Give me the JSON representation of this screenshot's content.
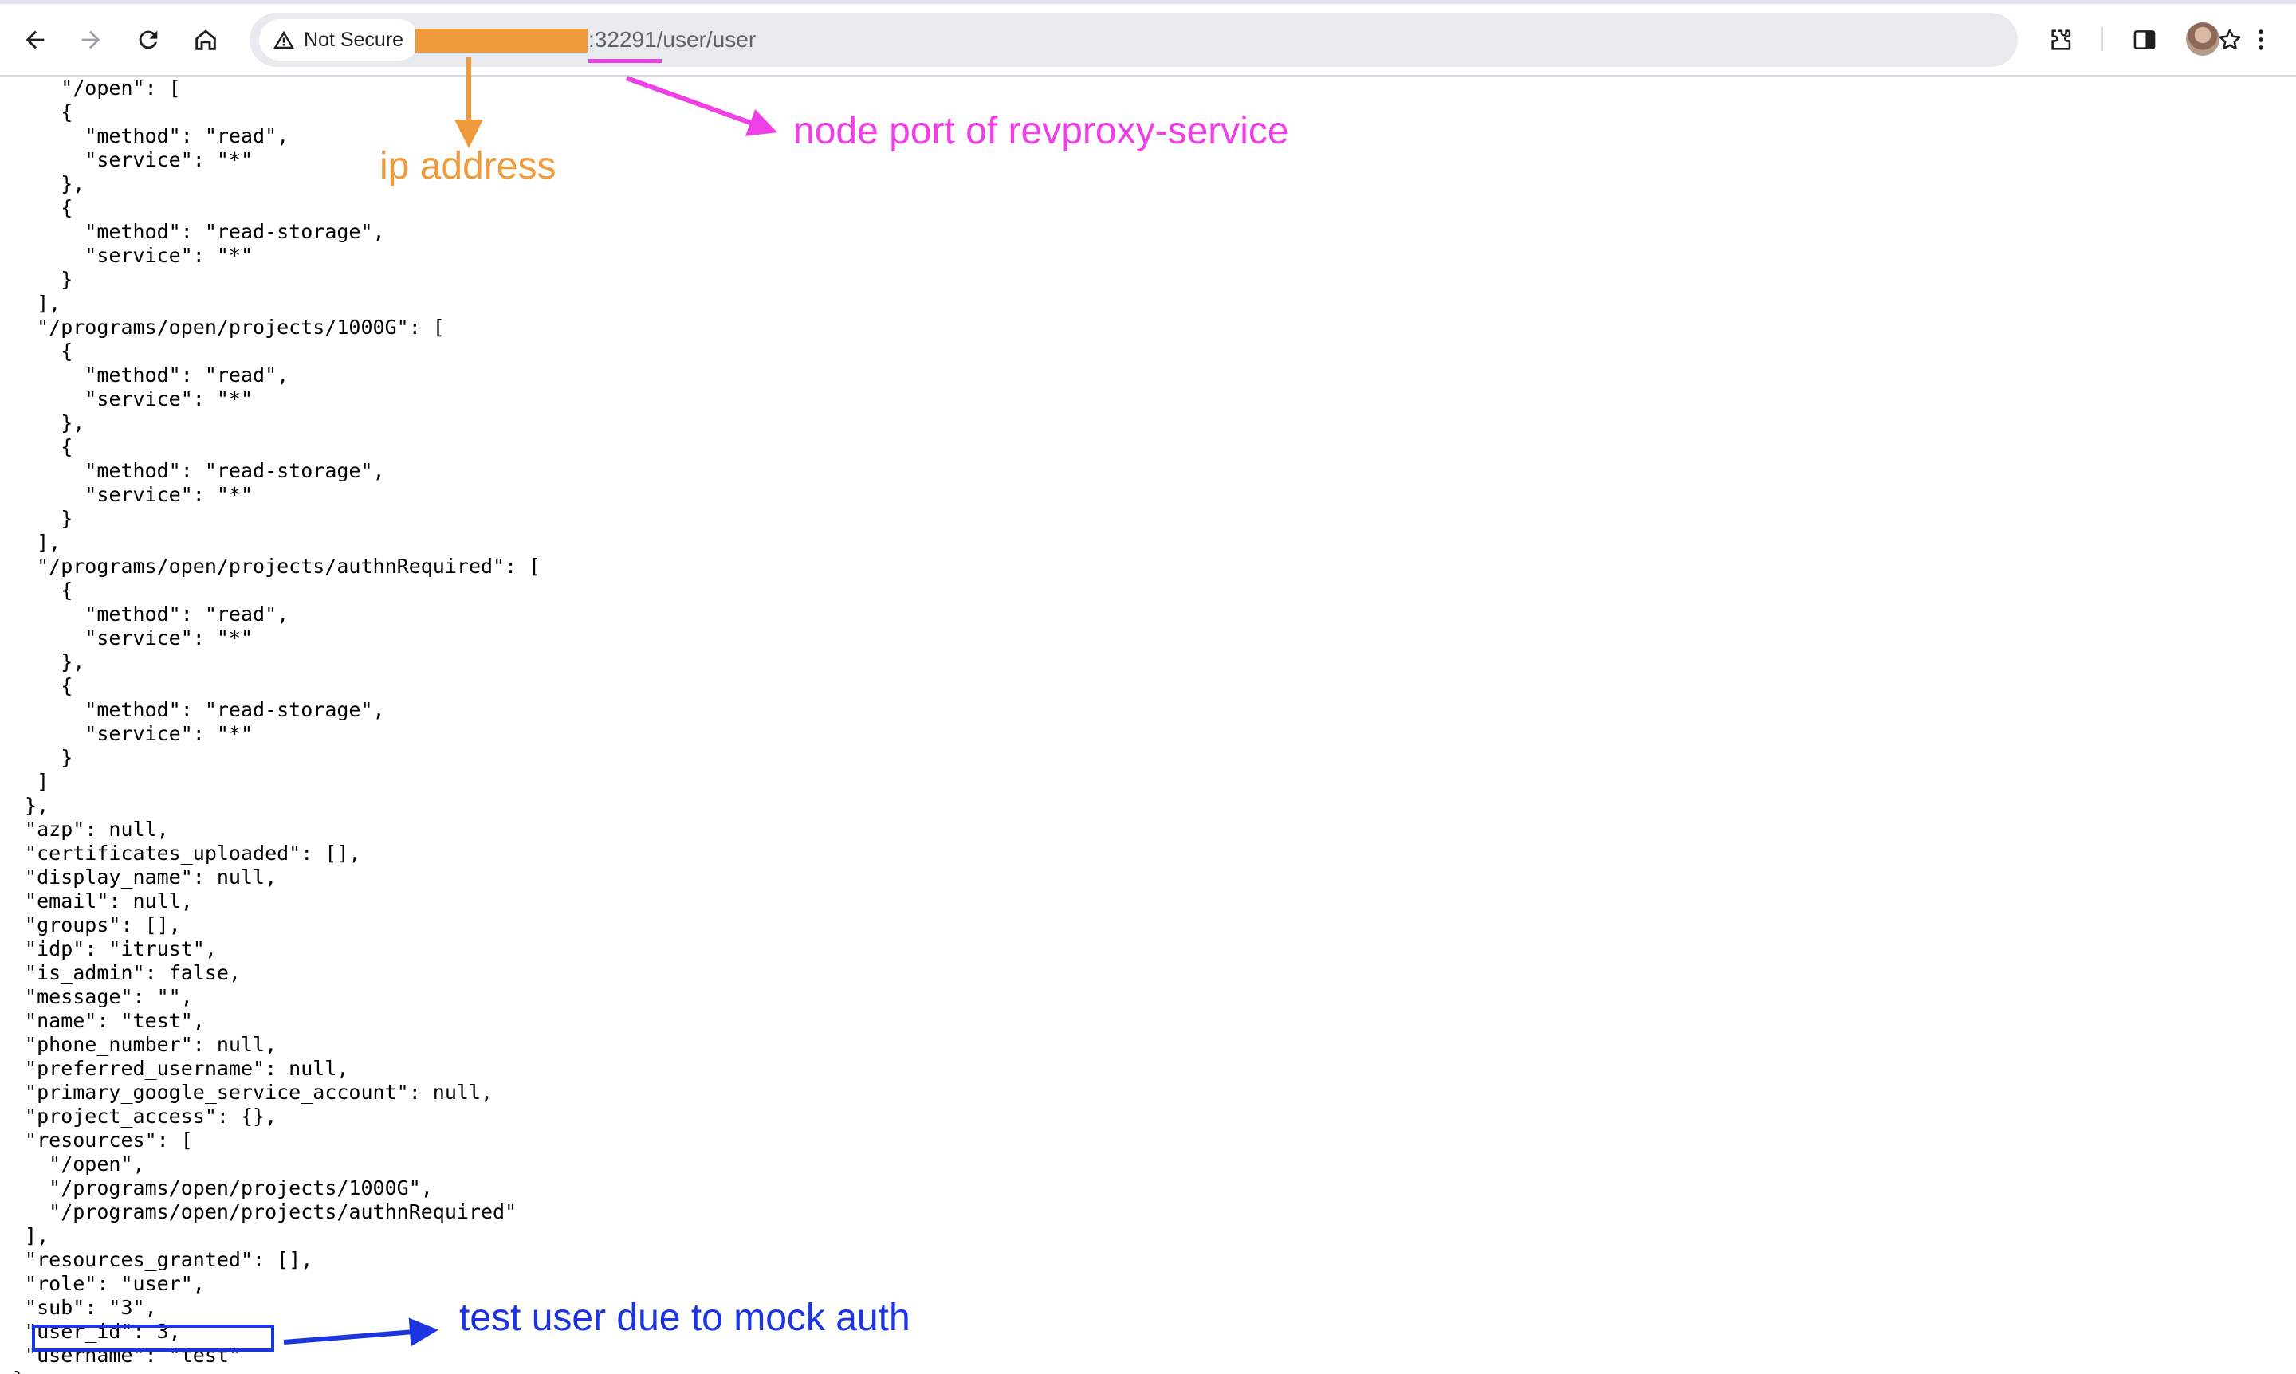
{
  "browser": {
    "security_label": "Not Secure",
    "url_visible_path": ":32291/user/user",
    "redacted_ip_color": "#ef9a3c"
  },
  "icons": {
    "back": "back-arrow-icon",
    "forward": "forward-arrow-icon",
    "reload": "reload-icon",
    "home": "home-icon",
    "warning": "warning-triangle-icon",
    "bookmark": "star-icon",
    "extensions": "puzzle-icon",
    "side_panel": "side-panel-icon",
    "profile": "avatar",
    "menu": "kebab-menu-icon"
  },
  "json_lines": [
    "    \"/open\": [",
    "    {",
    "      \"method\": \"read\",",
    "      \"service\": \"*\"",
    "    },",
    "    {",
    "      \"method\": \"read-storage\",",
    "      \"service\": \"*\"",
    "    }",
    "  ],",
    "  \"/programs/open/projects/1000G\": [",
    "    {",
    "      \"method\": \"read\",",
    "      \"service\": \"*\"",
    "    },",
    "    {",
    "      \"method\": \"read-storage\",",
    "      \"service\": \"*\"",
    "    }",
    "  ],",
    "  \"/programs/open/projects/authnRequired\": [",
    "    {",
    "      \"method\": \"read\",",
    "      \"service\": \"*\"",
    "    },",
    "    {",
    "      \"method\": \"read-storage\",",
    "      \"service\": \"*\"",
    "    }",
    "  ]",
    " },",
    " \"azp\": null,",
    " \"certificates_uploaded\": [],",
    " \"display_name\": null,",
    " \"email\": null,",
    " \"groups\": [],",
    " \"idp\": \"itrust\",",
    " \"is_admin\": false,",
    " \"message\": \"\",",
    " \"name\": \"test\",",
    " \"phone_number\": null,",
    " \"preferred_username\": null,",
    " \"primary_google_service_account\": null,",
    " \"project_access\": {},",
    " \"resources\": [",
    "   \"/open\",",
    "   \"/programs/open/projects/1000G\",",
    "   \"/programs/open/projects/authnRequired\"",
    " ],",
    " \"resources_granted\": [],",
    " \"role\": \"user\",",
    " \"sub\": \"3\",",
    " \"user_id\": 3,",
    " \"username\": \"test\"",
    "}"
  ],
  "annotations": {
    "ip_label": "ip address",
    "port_label": "node port of revproxy-service",
    "user_label": "test user due to mock auth",
    "ip_color": "#ef9a3c",
    "port_color": "#ef3fe6",
    "user_color": "#1b35e0"
  }
}
